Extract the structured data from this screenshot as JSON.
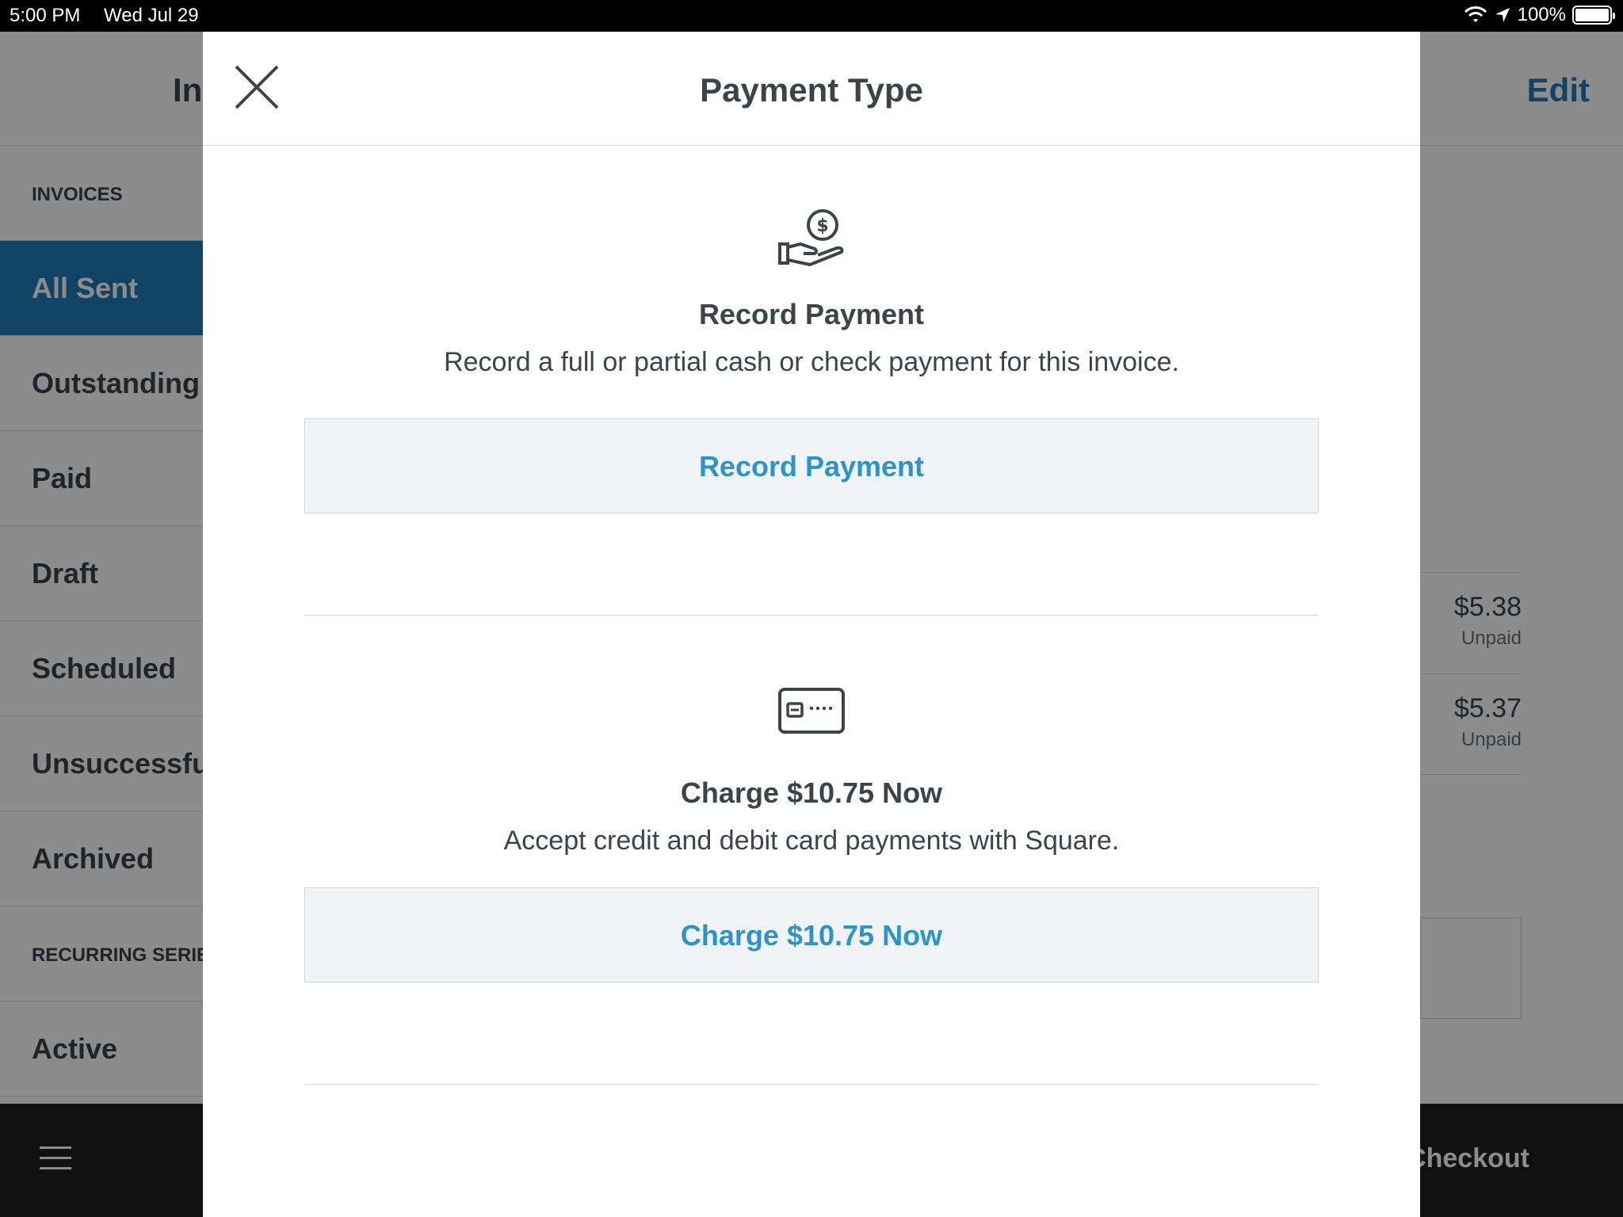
{
  "status_bar": {
    "time": "5:00 PM",
    "date": "Wed Jul 29",
    "battery": "100%",
    "icons": [
      "wifi-icon",
      "location-arrow-icon",
      "battery-icon"
    ]
  },
  "background": {
    "header_title": "In",
    "edit_label": "Edit",
    "sidebar": {
      "section_invoices": "INVOICES",
      "items": [
        {
          "label": "All Sent",
          "active": true
        },
        {
          "label": "Outstanding"
        },
        {
          "label": "Paid"
        },
        {
          "label": "Draft"
        },
        {
          "label": "Scheduled"
        },
        {
          "label": "Unsuccessful"
        },
        {
          "label": "Archived"
        }
      ],
      "section_recurring": "RECURRING SERIES",
      "recurring_items": [
        {
          "label": "Active"
        }
      ]
    },
    "invoices": [
      {
        "amount": "$5.38",
        "status": "Unpaid"
      },
      {
        "amount": "$5.37",
        "status": "Unpaid"
      }
    ],
    "bottom_bar": {
      "checkout_label": "Checkout"
    }
  },
  "modal": {
    "title": "Payment Type",
    "close_icon": "close-icon",
    "options": [
      {
        "icon": "hand-coin-icon",
        "title": "Record Payment",
        "description": "Record a full or partial cash or check payment for this invoice.",
        "button_label": "Record Payment"
      },
      {
        "icon": "credit-card-icon",
        "title": "Charge $10.75 Now",
        "description": "Accept credit and debit card payments with Square.",
        "button_label": "Charge $10.75 Now"
      }
    ]
  },
  "colors": {
    "accent": "#2a94cf",
    "active_sidebar": "#1f7ab8",
    "text": "#3d4348",
    "button_bg": "#f2f3f4"
  }
}
